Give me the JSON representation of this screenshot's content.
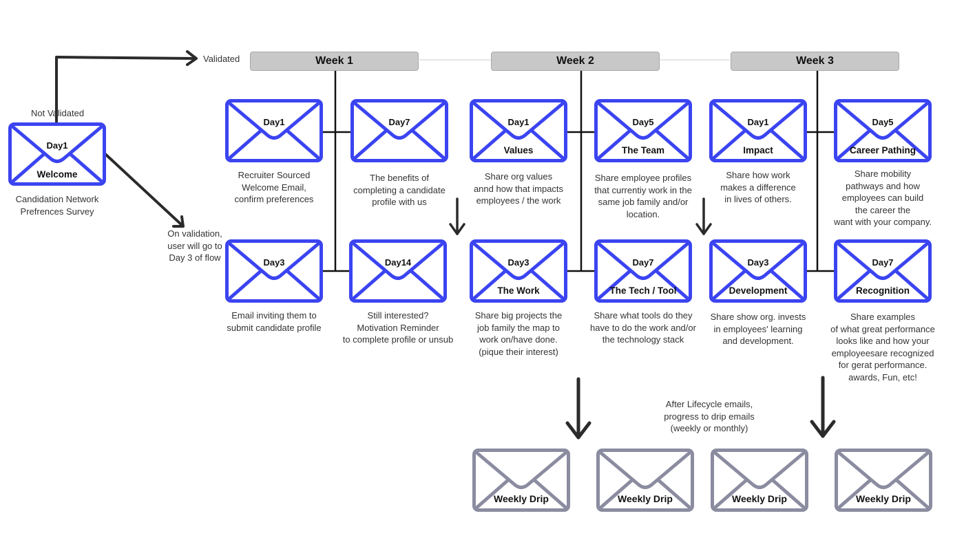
{
  "colors": {
    "lifecycle_envelope": "#3b44f0",
    "drip_envelope": "#8b8ca0",
    "week_header_fill": "#c8c8c8",
    "connector": "#111111",
    "arrow": "#2b2b2b"
  },
  "labels": {
    "validated": "Validated",
    "not_validated": "Not Validated",
    "on_validation": "On validation,\nuser will go to\nDay 3 of flow",
    "drip_note": "After Lifecycle emails,\nprogress to drip emails\n(weekly or monthly)"
  },
  "welcome": {
    "icon": "envelope-icon",
    "day": "Day1",
    "title": "Welcome",
    "description": "Candidation Network\nPrefrences Survey"
  },
  "weeks": [
    {
      "label": "Week 1",
      "emails": [
        {
          "icon": "envelope-icon",
          "day": "Day1",
          "title": "",
          "description": "Recruiter Sourced\nWelcome Email,\nconfirm preferences"
        },
        {
          "icon": "envelope-icon",
          "day": "Day7",
          "title": "",
          "description": "The benefits of\ncompleting a candidate\nprofile with us"
        },
        {
          "icon": "envelope-icon",
          "day": "Day3",
          "title": "",
          "description": "Email inviting them to\nsubmit candidate profile"
        },
        {
          "icon": "envelope-icon",
          "day": "Day14",
          "title": "",
          "description": "Still interested?\nMotivation Reminder\nto complete profile or unsub"
        }
      ]
    },
    {
      "label": "Week 2",
      "emails": [
        {
          "icon": "envelope-icon",
          "day": "Day1",
          "title": "Values",
          "description": "Share org values\nannd how that impacts\nemployees / the work"
        },
        {
          "icon": "envelope-icon",
          "day": "Day5",
          "title": "The Team",
          "description": "Share employee profiles\nthat currentiy work in the\nsame job family and/or\nlocation."
        },
        {
          "icon": "envelope-icon",
          "day": "Day3",
          "title": "The Work",
          "description": "Share big projects the\njob family the map to\nwork on/have done.\n(pique their interest)"
        },
        {
          "icon": "envelope-icon",
          "day": "Day7",
          "title": "The Tech / Tool",
          "description": "Share what tools do they\nhave to do the work and/or\nthe technology stack"
        }
      ]
    },
    {
      "label": "Week 3",
      "emails": [
        {
          "icon": "envelope-icon",
          "day": "Day1",
          "title": "Impact",
          "description": "Share how work\nmakes a  difference\nin lives  of others."
        },
        {
          "icon": "envelope-icon",
          "day": "Day5",
          "title": "Career Pathing",
          "description": "Share mobility\npathways and how\nemployees can build\nthe career the\nwant with your company."
        },
        {
          "icon": "envelope-icon",
          "day": "Day3",
          "title": "Development",
          "description": "Share show org. invests\nin employees' learning\nand development."
        },
        {
          "icon": "envelope-icon",
          "day": "Day7",
          "title": "Recognition",
          "description": "Share examples\nof what great performance\nlooks like and how your\nemployeesare  recognized\nfor gerat  performance.\nawards, Fun, etc!"
        }
      ]
    }
  ],
  "drips": [
    {
      "icon": "envelope-icon",
      "title": "Weekly Drip"
    },
    {
      "icon": "envelope-icon",
      "title": "Weekly Drip"
    },
    {
      "icon": "envelope-icon",
      "title": "Weekly Drip"
    },
    {
      "icon": "envelope-icon",
      "title": "Weekly Drip"
    }
  ]
}
